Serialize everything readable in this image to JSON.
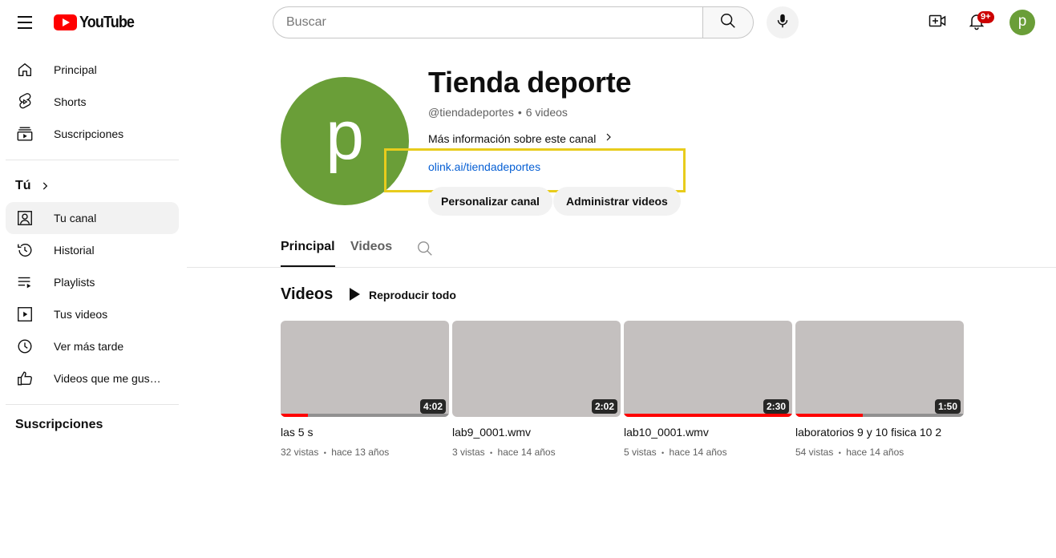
{
  "header": {
    "logo_text": "YouTube",
    "search_placeholder": "Buscar",
    "notification_badge": "9+",
    "avatar_letter": "p"
  },
  "sidebar": {
    "main": [
      {
        "label": "Principal",
        "icon": "home-icon"
      },
      {
        "label": "Shorts",
        "icon": "shorts-icon"
      },
      {
        "label": "Suscripciones",
        "icon": "subscriptions-icon"
      }
    ],
    "you_heading": "Tú",
    "you_items": [
      {
        "label": "Tu canal",
        "icon": "channel-icon",
        "active": true
      },
      {
        "label": "Historial",
        "icon": "history-icon"
      },
      {
        "label": "Playlists",
        "icon": "playlists-icon"
      },
      {
        "label": "Tus videos",
        "icon": "your-videos-icon"
      },
      {
        "label": "Ver más tarde",
        "icon": "watch-later-icon"
      },
      {
        "label": "Videos que me gus…",
        "icon": "liked-videos-icon"
      }
    ],
    "subscriptions_heading": "Suscripciones"
  },
  "channel": {
    "avatar_letter": "p",
    "name": "Tienda deporte",
    "handle": "@tiendadeportes",
    "separator": "•",
    "video_count": "6 videos",
    "more_info": "Más información sobre este canal",
    "link": "olink.ai/tiendadeportes",
    "customize_label": "Personalizar canal",
    "manage_label": "Administrar videos"
  },
  "tabs": {
    "principal": "Principal",
    "videos": "Videos"
  },
  "videos_section": {
    "title": "Videos",
    "play_all": "Reproducir todo",
    "items": [
      {
        "title": "las 5 s",
        "views": "32 vistas",
        "age": "hace 13 años",
        "duration": "4:02",
        "progress": 0.16
      },
      {
        "title": "lab9_0001.wmv",
        "views": "3 vistas",
        "age": "hace 14 años",
        "duration": "2:02",
        "progress": 0
      },
      {
        "title": "lab10_0001.wmv",
        "views": "5 vistas",
        "age": "hace 14 años",
        "duration": "2:30",
        "progress": 1.0
      },
      {
        "title": "laboratorios 9 y 10 fisica 10 2",
        "views": "54 vistas",
        "age": "hace 14 años",
        "duration": "1:50",
        "progress": 0.4
      }
    ],
    "meta_separator": "•"
  },
  "colors": {
    "avatar_green": "#6a9e38",
    "link_blue": "#065fd4",
    "highlight_yellow": "#e8cc1c",
    "progress_red": "#ff0000"
  }
}
